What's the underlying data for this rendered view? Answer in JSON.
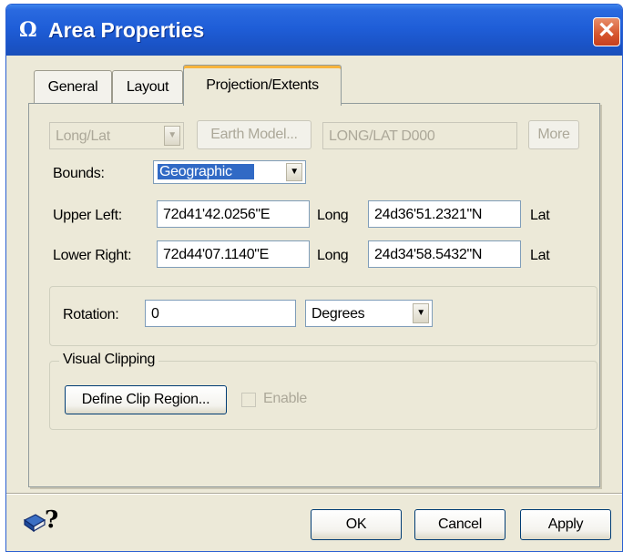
{
  "window": {
    "title": "Area Properties",
    "icon": "globe-app-icon",
    "close_glyph": "✕"
  },
  "tabs": [
    {
      "label": "General",
      "active": false
    },
    {
      "label": "Layout",
      "active": false
    },
    {
      "label": "Projection/Extents",
      "active": true
    }
  ],
  "projection": {
    "system_value": "Long/Lat",
    "earth_model_button": "Earth Model...",
    "projection_string": "LONG/LAT    D000",
    "more_button": "More"
  },
  "bounds": {
    "label": "Bounds:",
    "value": "Geographic"
  },
  "upper_left": {
    "label": "Upper Left:",
    "long": "72d41'42.0256\"E",
    "long_unit": "Long",
    "lat": "24d36'51.2321\"N",
    "lat_unit": "Lat"
  },
  "lower_right": {
    "label": "Lower Right:",
    "long": "72d44'07.1140\"E",
    "long_unit": "Long",
    "lat": "24d34'58.5432\"N",
    "lat_unit": "Lat"
  },
  "rotation": {
    "label": "Rotation:",
    "value": "0",
    "unit": "Degrees"
  },
  "visual_clipping": {
    "title": "Visual Clipping",
    "define_button": "Define Clip Region...",
    "enable_label": "Enable",
    "enable_checked": false
  },
  "footer": {
    "help_icon": "help-book-icon",
    "help_glyph": "?",
    "ok": "OK",
    "cancel": "Cancel",
    "apply": "Apply"
  },
  "colors": {
    "titlebar": "#1f5ed8",
    "dialog_bg": "#ece9d8",
    "selection": "#316ac5"
  }
}
